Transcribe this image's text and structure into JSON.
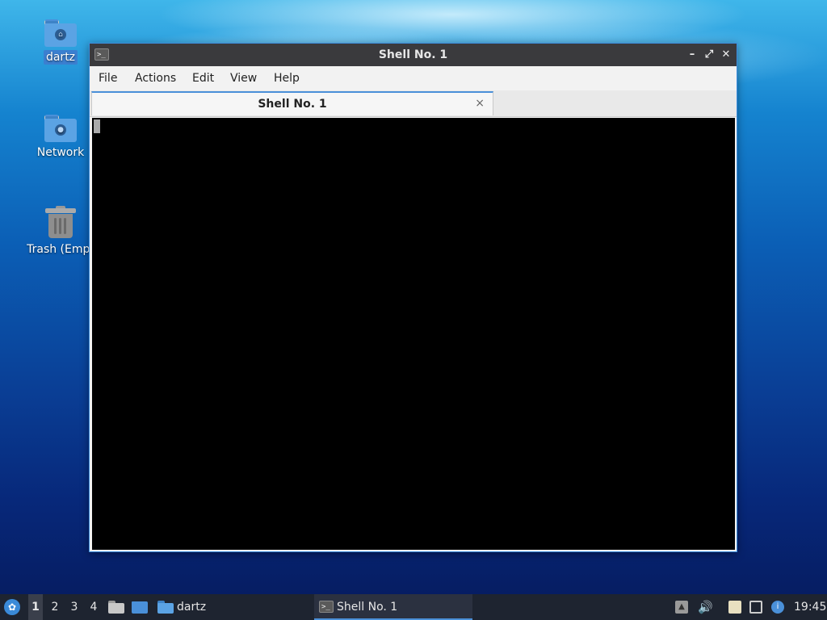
{
  "desktop": {
    "icons": [
      {
        "label": "dartz",
        "icon": "home-folder-icon"
      },
      {
        "label": "Network",
        "icon": "network-folder-icon"
      },
      {
        "label": "Trash (Empt",
        "icon": "trash-icon"
      }
    ]
  },
  "window": {
    "title": "Shell No. 1",
    "controls": {
      "minimize": "–",
      "maximize": "⤢",
      "close": "✕"
    },
    "menu": [
      "File",
      "Actions",
      "Edit",
      "View",
      "Help"
    ],
    "tabs": [
      {
        "label": "Shell No. 1",
        "close": "×"
      }
    ],
    "terminal": {
      "content": "",
      "background": "#000000"
    }
  },
  "taskbar": {
    "workspaces": [
      "1",
      "2",
      "3",
      "4"
    ],
    "active_workspace": "1",
    "launchers": [
      {
        "name": "file-manager-icon"
      },
      {
        "name": "show-desktop-icon"
      }
    ],
    "folder_task": {
      "label": "dartz"
    },
    "active_task": {
      "label": "Shell No. 1"
    },
    "tray": [
      "upload-icon",
      "volume-icon",
      "clipboard-icon",
      "network-icon",
      "notification-icon"
    ],
    "clock": "19:45"
  },
  "colors": {
    "accent": "#4a90d9",
    "titlebar": "#3a3a3d",
    "taskbar": "#1e2430"
  }
}
